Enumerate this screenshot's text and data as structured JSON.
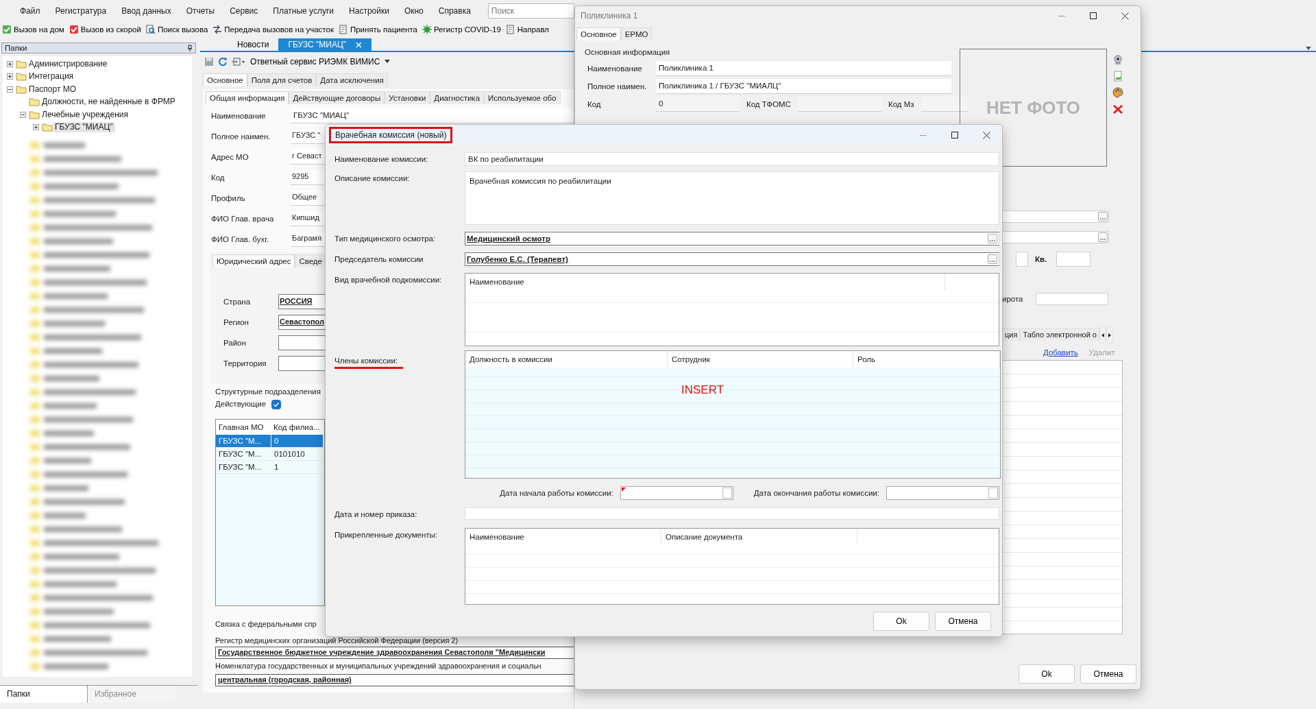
{
  "menu": [
    "Файл",
    "Регистратура",
    "Ввод данных",
    "Отчеты",
    "Сервис",
    "Платные услуги",
    "Настройки",
    "Окно",
    "Справка"
  ],
  "search": {
    "placeholder": "Поиск"
  },
  "toolbar": [
    {
      "label": "Вызов на дом",
      "kind": "check"
    },
    {
      "label": "Вызов из скорой",
      "kind": "redcheck"
    },
    {
      "label": "Поиск вызова",
      "kind": "search"
    },
    {
      "label": "Передача вызовов на участок",
      "kind": "transfer"
    },
    {
      "label": "Принять пациента",
      "kind": "doc"
    },
    {
      "label": "Регистр COVID-19",
      "kind": "virus"
    },
    {
      "label": "Направл",
      "kind": "doc"
    }
  ],
  "folders": {
    "title": "Папки",
    "tree": [
      {
        "label": "Администрирование",
        "kind": "branch",
        "expanded": false,
        "selected": false
      },
      {
        "label": "Интеграция",
        "kind": "branch",
        "expanded": false,
        "selected": false
      },
      {
        "label": "Паспорт МО",
        "kind": "branch",
        "expanded": true,
        "selected": false,
        "children": [
          {
            "label": "Должности, не найденные в ФРМР",
            "kind": "leaf",
            "selected": false
          },
          {
            "label": "Лечебные учреждения",
            "kind": "branch",
            "expanded": true,
            "selected": false,
            "children": [
              {
                "label": "ГБУЗС \"МИАЦ\"",
                "kind": "branch",
                "expanded": false,
                "selected": true
              }
            ]
          }
        ]
      }
    ],
    "tabs": [
      {
        "label": "Папки",
        "selected": true
      },
      {
        "label": "Избранное",
        "selected": false
      }
    ]
  },
  "doc_tabs": [
    {
      "label": "Новости",
      "selected": false,
      "closable": false
    },
    {
      "label": "ГБУЗС \"МИАЦ\"",
      "selected": true,
      "closable": true
    }
  ],
  "service_menu": "Ответный сервис РИЭМК ВИМИС",
  "main_tabs": [
    {
      "label": "Основное",
      "selected": true
    },
    {
      "label": "Поля для счетов",
      "selected": false
    },
    {
      "label": "Дата исключения",
      "selected": false
    }
  ],
  "sub_tabs": [
    {
      "label": "Общая информация",
      "selected": true
    },
    {
      "label": "Действующие договоры",
      "selected": false
    },
    {
      "label": "Установки",
      "selected": false
    },
    {
      "label": "Диагностика",
      "selected": false
    },
    {
      "label": "Используемое обо",
      "selected": false
    }
  ],
  "org_fields": [
    {
      "label": "Наименование",
      "value": "ГБУЗС \"МИАЦ\""
    },
    {
      "label": "Полное наимен.",
      "value": "ГБУЗС \""
    },
    {
      "label": "Адрес МО",
      "value": "г Севаст"
    },
    {
      "label": "Код",
      "value": "9295"
    },
    {
      "label": "Профиль",
      "value": "Общее"
    },
    {
      "label": "ФИО Глав. врача",
      "value": "Кипшид"
    },
    {
      "label": "ФИО Глав. бухг.",
      "value": "Баграмя"
    }
  ],
  "address_tabs": [
    {
      "label": "Юридический адрес",
      "selected": true
    },
    {
      "label": "Сведе",
      "selected": false
    }
  ],
  "address_fields": [
    {
      "label": "Страна",
      "kind": "lookup",
      "value": "РОССИЯ"
    },
    {
      "label": "Регион",
      "kind": "lookup",
      "value": "Севастопол"
    },
    {
      "label": "Район",
      "kind": "text"
    },
    {
      "label": "Территория",
      "kind": "text"
    }
  ],
  "units": {
    "title": "Структурные подразделения",
    "active_label": "Действующие",
    "active": true,
    "columns": [
      "Главная МО",
      "Код филиа..."
    ],
    "rows": [
      {
        "cells": [
          "ГБУЗС \"М...",
          "0"
        ],
        "selected": true
      },
      {
        "cells": [
          "ГБУЗС \"М...",
          "0101010"
        ],
        "selected": false
      },
      {
        "cells": [
          "ГБУЗС \"М...",
          "1"
        ],
        "selected": false
      }
    ]
  },
  "federal": {
    "title": "Связка с федеральными спр",
    "register_label": "Регистр медицинских организаций Российской Федерации (версия 2)",
    "register_value": "Государственное бюджетное учреждение здравоохранения Севастополя \"Медицински",
    "nomenclature_label": "Номенклатура государственных и муниципальных учреждений здравоохранения и социальн",
    "nomenclature_value": "центральная (городская, районная)"
  },
  "clinic_window": {
    "title": "Поликлиника 1",
    "tabs": [
      {
        "label": "Основное",
        "selected": true
      },
      {
        "label": "ЕРМО",
        "selected": false
      }
    ],
    "group_title": "Основная информация",
    "fields": [
      {
        "label": "Наименование",
        "value": "Поликлиника 1"
      },
      {
        "label": "Полное наимен.",
        "value": "Поликлиника 1 / ГБУЗС \"МИАЛЦ\""
      }
    ],
    "code_fields": [
      {
        "label": "Код",
        "value": "0"
      },
      {
        "label": "Код ТФОМС"
      },
      {
        "label": "Код Мз"
      }
    ],
    "photo_text": "НЕТ ФОТО",
    "flat_label": "Кв.",
    "latitude_label": "ирота",
    "lower_tabs": [
      {
        "label": "ция",
        "selected": false
      },
      {
        "label": "Табло электронной о",
        "selected": false
      }
    ],
    "add_link": "Добавить",
    "delete_link": {
      "label": "Удалит",
      "disabled": true
    },
    "buttons": [
      "Ok",
      "Отмена"
    ]
  },
  "dialog": {
    "title": "Врачебная комиссия (новый)",
    "title_highlighted": true,
    "name_label": "Наименование комиссии:",
    "name_value": "ВК по реабилитации",
    "desc_label": "Описание комиссии:",
    "desc_value": "Врачебная комиссия по реабилитации",
    "type_label": "Тип медицинского осмотра:",
    "type_value": "Медицинский осмотр",
    "chair_label": "Председатель комиссии",
    "chair_value": "Голубенко Е.С. (Терапевт)",
    "sub_label": "Вид врачебной подкомиссии:",
    "sub_columns": [
      "Наименование"
    ],
    "members_label": "Члены комиссии:",
    "members_underlined": true,
    "members_columns": [
      "Должность в комиссии",
      "Сотрудник",
      "Роль"
    ],
    "members_mode": "INSERT",
    "start_label": "Дата начала работы комиссии:",
    "start_required": true,
    "end_label": "Дата окончания работы комиссии:",
    "order_label": "Дата и номер приказа:",
    "docs_label": "Прикрепленные документы:",
    "docs_columns": [
      "Наименование",
      "Описание документа"
    ],
    "buttons": [
      "Ok",
      "Отмена"
    ]
  }
}
